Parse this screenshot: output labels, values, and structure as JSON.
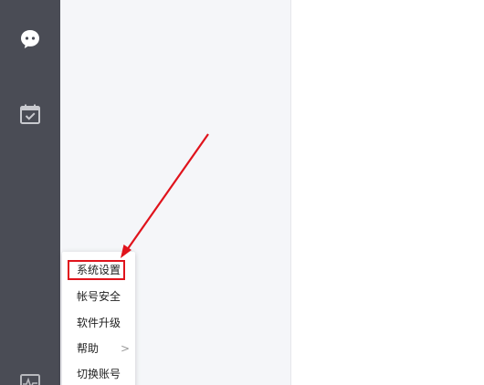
{
  "sidebar": {
    "items": [
      {
        "icon": "chat-bubble-icon"
      },
      {
        "icon": "calendar-check-icon"
      },
      {
        "icon": "activity-icon"
      }
    ]
  },
  "menu": {
    "items": [
      {
        "label": "系统设置"
      },
      {
        "label": "帐号安全"
      },
      {
        "label": "软件升级"
      },
      {
        "label": "帮助",
        "chevron": ">"
      },
      {
        "label": "切换账号"
      }
    ]
  },
  "annotation": {
    "color": "#e0131c"
  }
}
